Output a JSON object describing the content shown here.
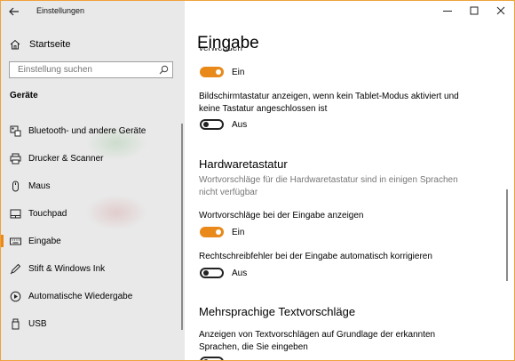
{
  "app": {
    "title": "Einstellungen"
  },
  "colors": {
    "accent": "#e8891a",
    "sidebar_bg": "#e9e9e9",
    "window_border": "#f0a23c"
  },
  "sidebar": {
    "home_label": "Startseite",
    "search_placeholder": "Einstellung suchen",
    "section_title": "Geräte",
    "items": [
      {
        "label": "Bluetooth- und andere Geräte",
        "icon": "bluetooth-devices-icon",
        "selected": false
      },
      {
        "label": "Drucker & Scanner",
        "icon": "printer-icon",
        "selected": false
      },
      {
        "label": "Maus",
        "icon": "mouse-icon",
        "selected": false
      },
      {
        "label": "Touchpad",
        "icon": "touchpad-icon",
        "selected": false
      },
      {
        "label": "Eingabe",
        "icon": "keyboard-icon",
        "selected": true
      },
      {
        "label": "Stift & Windows Ink",
        "icon": "pen-icon",
        "selected": false
      },
      {
        "label": "Automatische Wiedergabe",
        "icon": "autoplay-icon",
        "selected": false
      },
      {
        "label": "USB",
        "icon": "usb-icon",
        "selected": false
      }
    ]
  },
  "main": {
    "title": "Eingabe",
    "cut_label": "verwenden",
    "settings": [
      {
        "label": "",
        "state": "Ein",
        "on": true
      },
      {
        "label": "Bildschirmtastatur anzeigen, wenn kein Tablet-Modus aktiviert und keine Tastatur angeschlossen ist",
        "state": "Aus",
        "on": false
      }
    ],
    "hardware": {
      "title": "Hardwaretastatur",
      "note": "Wortvorschläge für die Hardwaretastatur sind in einigen Sprachen nicht verfügbar",
      "settings": [
        {
          "label": "Wortvorschläge bei der Eingabe anzeigen",
          "state": "Ein",
          "on": true
        },
        {
          "label": "Rechtschreibfehler bei der Eingabe automatisch korrigieren",
          "state": "Aus",
          "on": false
        }
      ]
    },
    "multilingual": {
      "title": "Mehrsprachige Textvorschläge",
      "setting_label": "Anzeigen von Textvorschlägen auf Grundlage der erkannten Sprachen, die Sie eingeben"
    }
  }
}
